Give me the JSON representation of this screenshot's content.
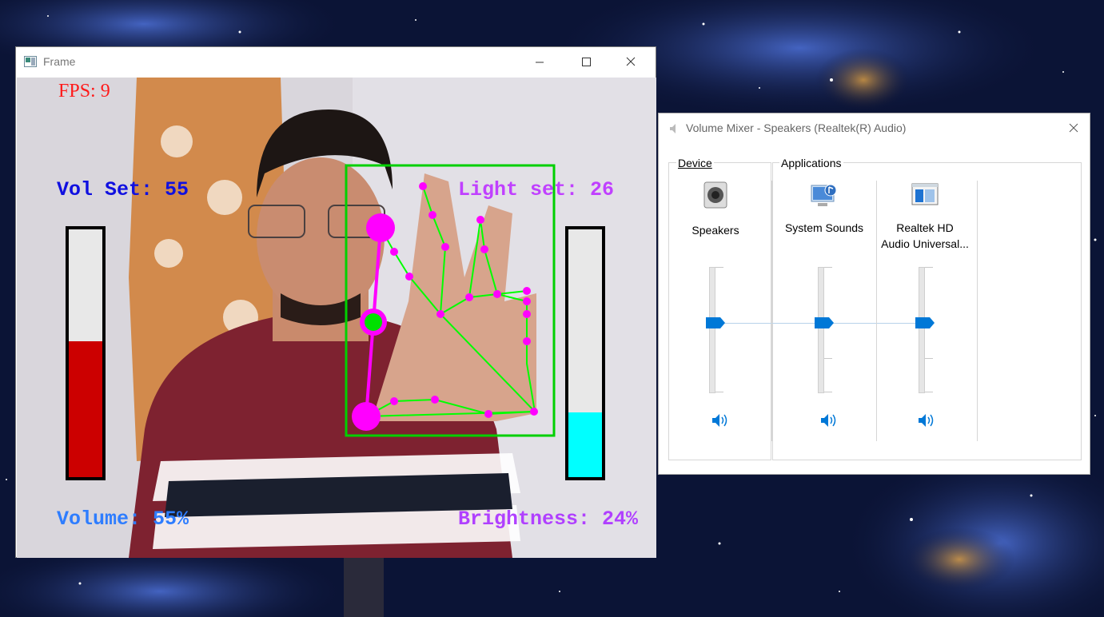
{
  "desktop": {
    "wallpaper": "starry-night-space"
  },
  "frame_window": {
    "title": "Frame",
    "icon": "app-window-icon",
    "overlay": {
      "fps": "FPS: 9",
      "vol_set": "Vol Set: 55",
      "light_set": "Light set: 26",
      "volume": "Volume: 55%",
      "brightness": "Brightness: 24%"
    },
    "volume_level": 0.55,
    "brightness_level": 0.26,
    "colors": {
      "volume_fill": "#cc0000",
      "brightness_fill": "#00ffff",
      "hand_box": "#00d000",
      "landmarks": "#ff00ff"
    }
  },
  "mixer_window": {
    "title": "Volume Mixer - Speakers (Realtek(R) Audio)",
    "device_group_label": "Device",
    "applications_group_label": "Applications",
    "channels": [
      {
        "name": "Speakers",
        "icon": "speaker-device-icon",
        "level": 0.55
      },
      {
        "name": "System Sounds",
        "icon": "system-sounds-icon",
        "level": 0.55
      },
      {
        "name_line1": "Realtek HD",
        "name_line2": "Audio Universal...",
        "icon": "realtek-app-icon",
        "level": 0.55
      }
    ],
    "accent_color": "#0078d7"
  }
}
